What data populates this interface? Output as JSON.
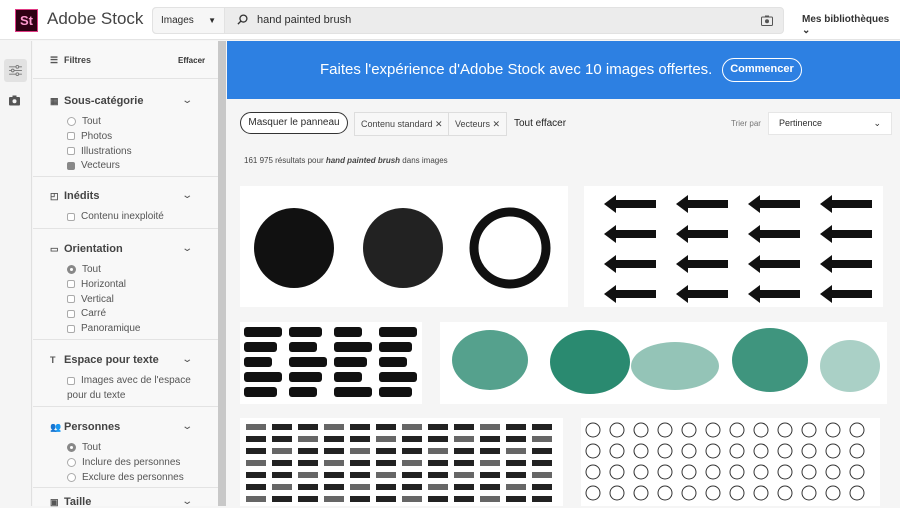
{
  "header": {
    "logo": "St",
    "brand": "Adobe Stock",
    "search_type": "Images",
    "search_query": "hand painted brush",
    "libraries": "Mes bibliothèques"
  },
  "sidebar": {
    "title": "Filtres",
    "clear": "Effacer",
    "sections": [
      {
        "title": "Sous-catégorie",
        "items": [
          {
            "label": "Tout",
            "type": "radio",
            "checked": false
          },
          {
            "label": "Photos",
            "type": "checkbox",
            "checked": false
          },
          {
            "label": "Illustrations",
            "type": "checkbox",
            "checked": false
          },
          {
            "label": "Vecteurs",
            "type": "checkbox",
            "checked": true
          }
        ]
      },
      {
        "title": "Inédits",
        "items": [
          {
            "label": "Contenu inexploité",
            "type": "checkbox",
            "checked": false
          }
        ]
      },
      {
        "title": "Orientation",
        "items": [
          {
            "label": "Tout",
            "type": "radio",
            "checked": true
          },
          {
            "label": "Horizontal",
            "type": "checkbox",
            "checked": false
          },
          {
            "label": "Vertical",
            "type": "checkbox",
            "checked": false
          },
          {
            "label": "Carré",
            "type": "checkbox",
            "checked": false
          },
          {
            "label": "Panoramique",
            "type": "checkbox",
            "checked": false
          }
        ]
      },
      {
        "title": "Espace pour texte",
        "items": [
          {
            "label": "Images avec de l'espace",
            "type": "checkbox",
            "checked": false
          },
          {
            "label": "pour du texte",
            "type": "none"
          }
        ]
      },
      {
        "title": "Personnes",
        "items": [
          {
            "label": "Tout",
            "type": "radio",
            "checked": true
          },
          {
            "label": "Inclure des personnes",
            "type": "radio",
            "checked": false
          },
          {
            "label": "Exclure des personnes",
            "type": "radio",
            "checked": false
          }
        ]
      },
      {
        "title": "Taille",
        "items": []
      }
    ]
  },
  "banner": {
    "text": "Faites l'expérience d'Adobe Stock avec 10 images offertes.",
    "button": "Commencer"
  },
  "toolbar": {
    "hide_panel": "Masquer le panneau",
    "chips": [
      "Contenu standard ✕",
      "Vecteurs ✕"
    ],
    "clear_all": "Tout effacer",
    "sort_label": "Trier par",
    "sort_value": "Pertinence"
  },
  "results": {
    "count": "161 975 résultats pour ",
    "query": "hand painted brush",
    "suffix": " dans images"
  },
  "colors": {
    "banner": "#2d80e2",
    "logo_bg": "#300014"
  }
}
